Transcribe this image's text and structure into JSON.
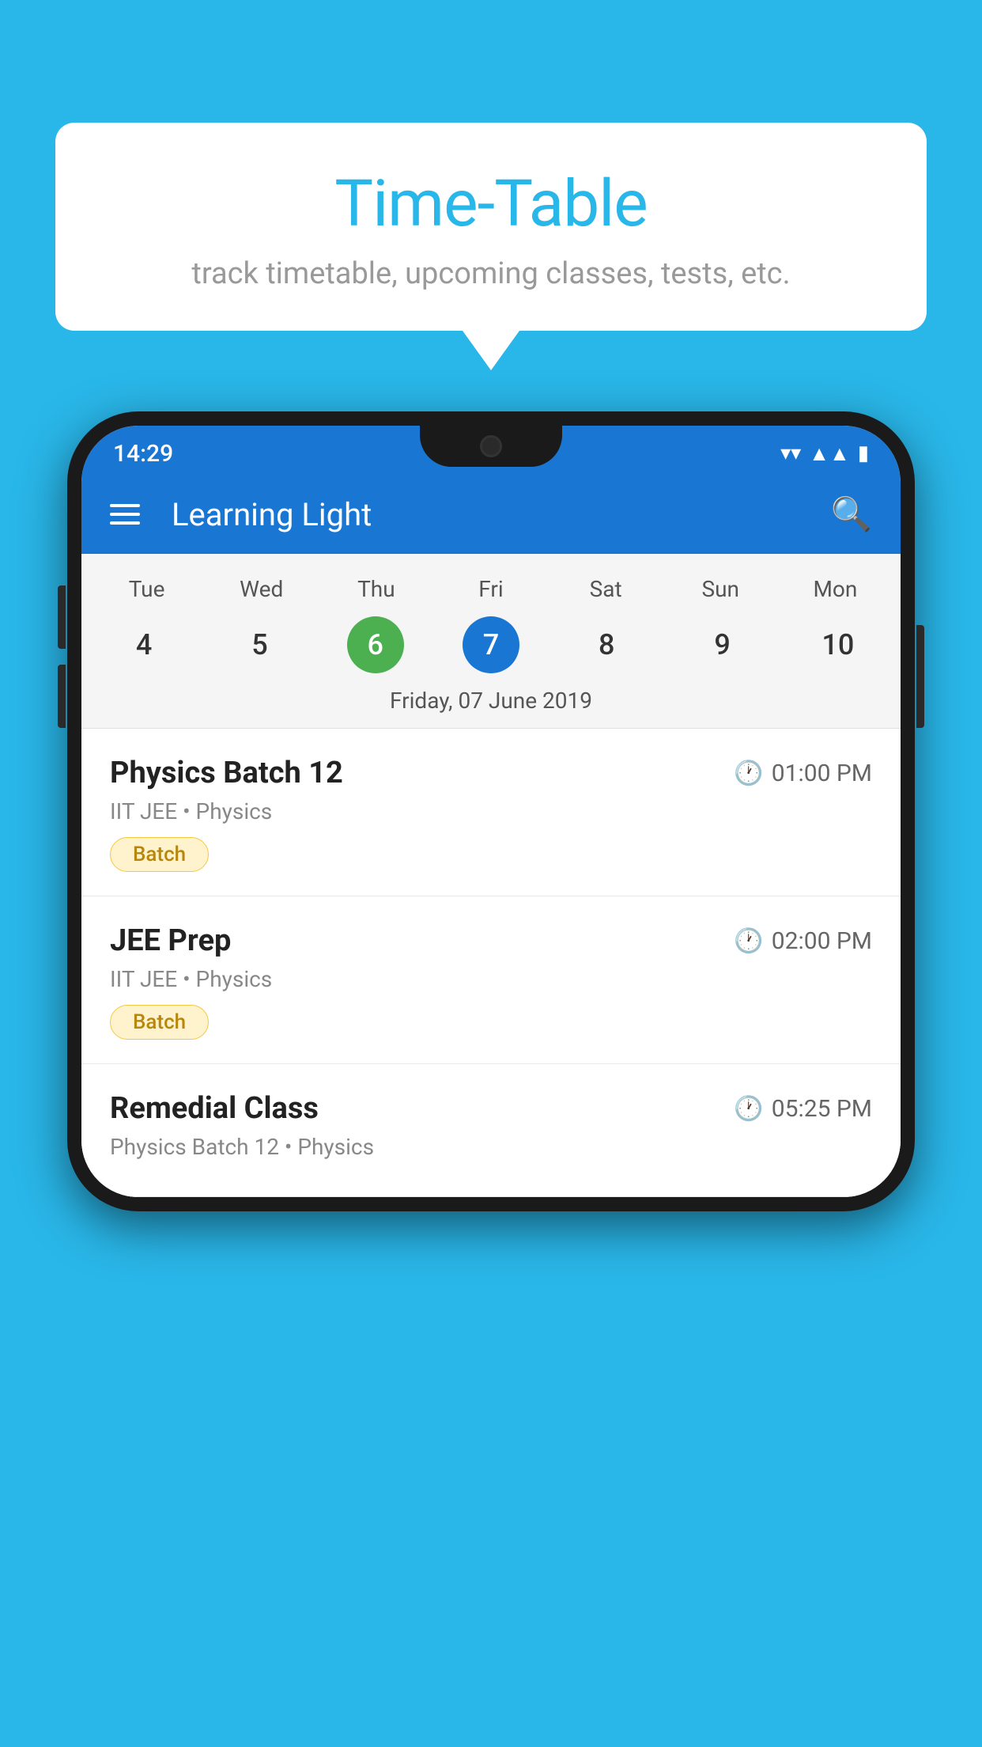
{
  "background_color": "#29b6e8",
  "speech_bubble": {
    "title": "Time-Table",
    "subtitle": "track timetable, upcoming classes, tests, etc."
  },
  "phone": {
    "status_bar": {
      "time": "14:29"
    },
    "app_bar": {
      "title": "Learning Light"
    },
    "calendar": {
      "days_of_week": [
        "Tue",
        "Wed",
        "Thu",
        "Fri",
        "Sat",
        "Sun",
        "Mon"
      ],
      "day_numbers": [
        "4",
        "5",
        "6",
        "7",
        "8",
        "9",
        "10"
      ],
      "today_index": 2,
      "selected_index": 3,
      "date_label": "Friday, 07 June 2019"
    },
    "schedule": [
      {
        "title": "Physics Batch 12",
        "time": "01:00 PM",
        "meta": "IIT JEE • Physics",
        "tag": "Batch"
      },
      {
        "title": "JEE Prep",
        "time": "02:00 PM",
        "meta": "IIT JEE • Physics",
        "tag": "Batch"
      },
      {
        "title": "Remedial Class",
        "time": "05:25 PM",
        "meta": "Physics Batch 12 • Physics",
        "tag": ""
      }
    ]
  }
}
